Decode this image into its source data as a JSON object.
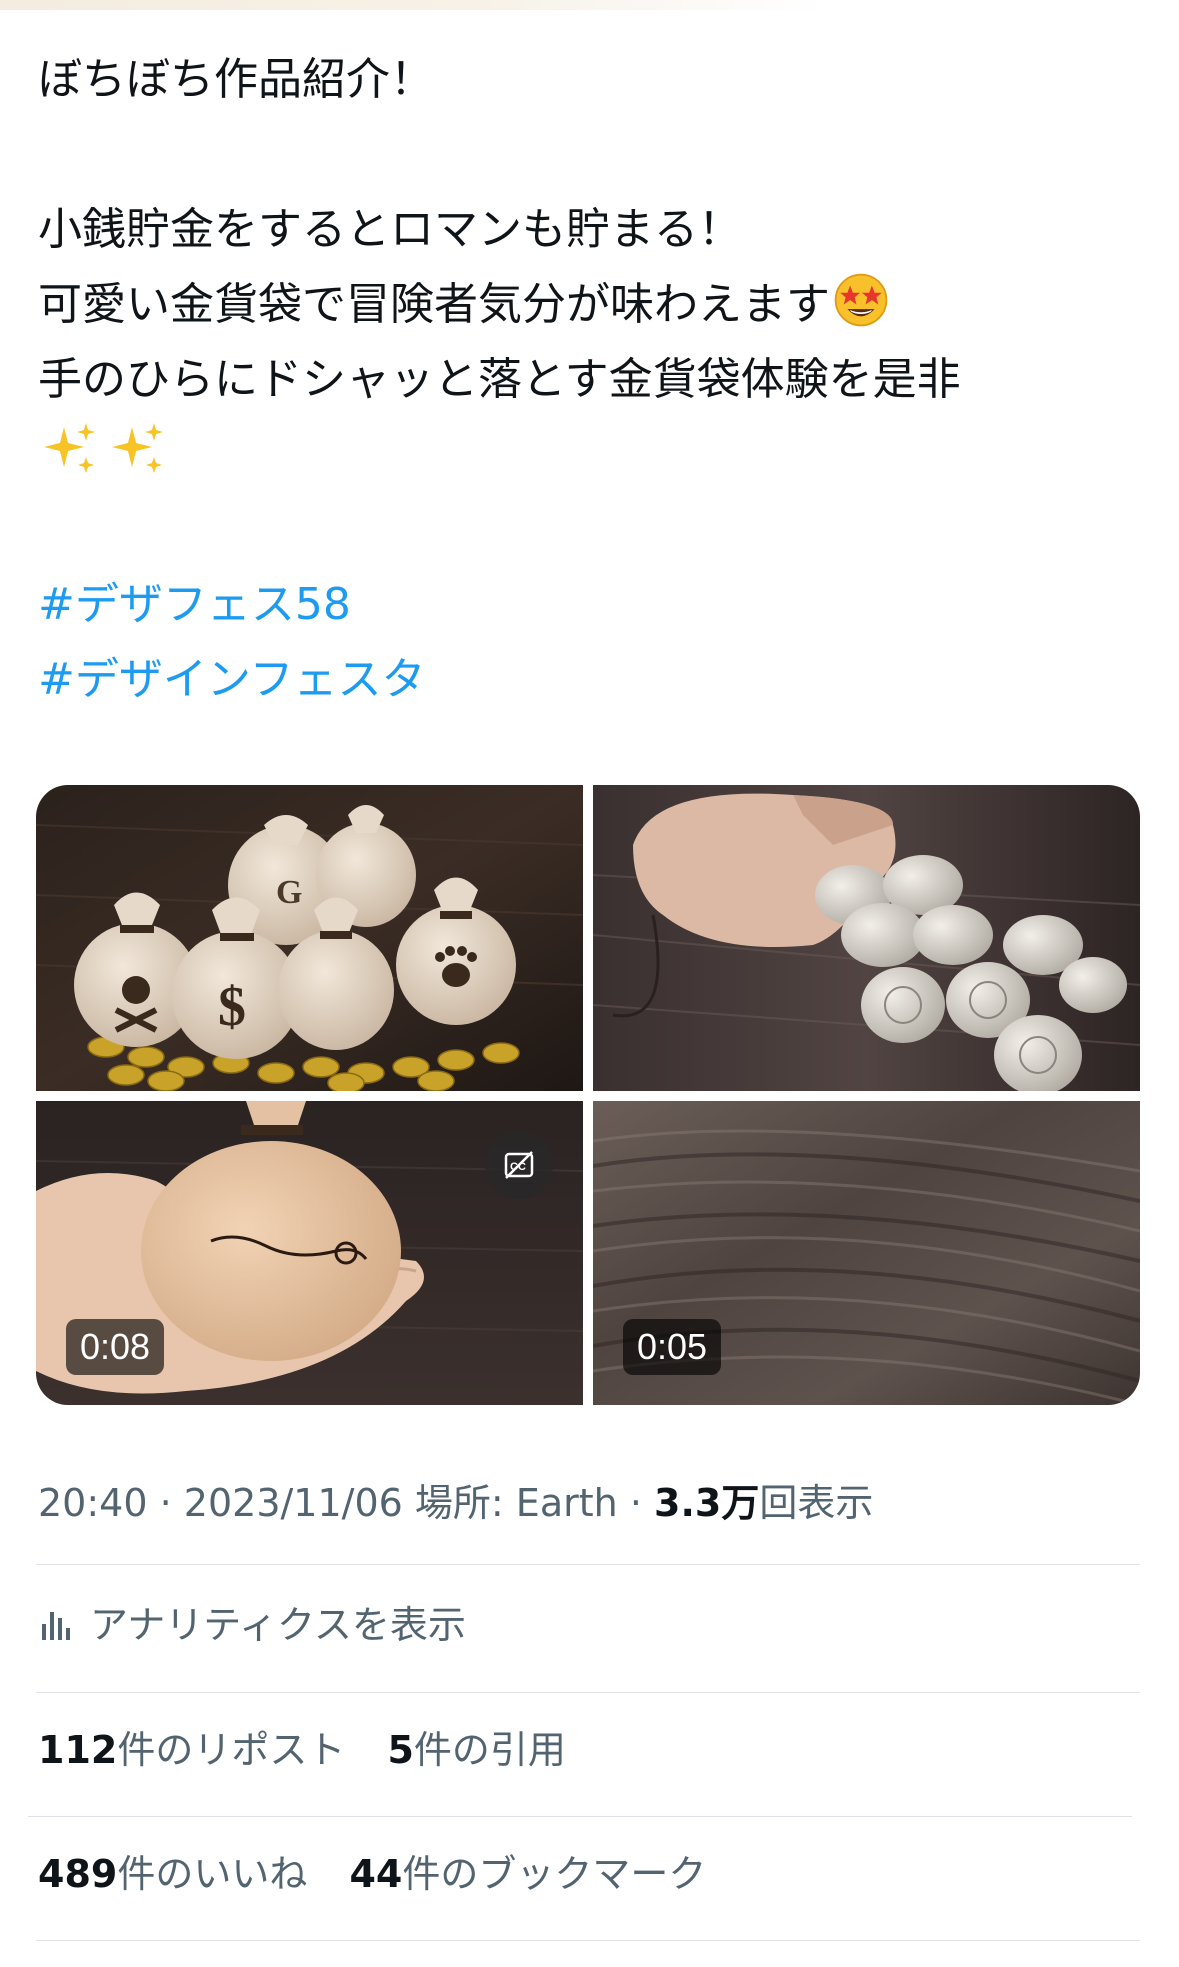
{
  "tweet": {
    "line1": "ぼちぼち作品紹介！",
    "line2": "小銭貯金をするとロマンも貯まる！",
    "line3": "可愛い金貨袋で冒険者気分が味わえます",
    "line3_emoji": "star-struck-emoji",
    "line4": "手のひらにドシャッと落とす金貨袋体験を是非",
    "line5_emoji": "sparkles-emoji",
    "hashtag1": "#デザフェス58",
    "hashtag2": "#デザインフェスタ"
  },
  "media": [
    {
      "type": "photo",
      "subject": "money-bags-with-gold-coins"
    },
    {
      "type": "photo",
      "subject": "leather-pouch-with-yen-coins"
    },
    {
      "type": "video",
      "duration": "0:08",
      "subject": "pouch-in-hand",
      "icon": "captions-off-icon"
    },
    {
      "type": "video",
      "duration": "0:05",
      "subject": "wooden-table"
    }
  ],
  "meta": {
    "time": "20:40",
    "sep1": "·",
    "date": "2023/11/06",
    "location_label": "場所: Earth",
    "sep2": "·",
    "views_count": "3.3万",
    "views_label": "回表示"
  },
  "analytics": {
    "icon": "bar-chart-icon",
    "label": "アナリティクスを表示"
  },
  "stats": {
    "reposts_count": "112",
    "reposts_label": "件のリポスト",
    "quotes_count": "5",
    "quotes_label": "件の引用",
    "likes_count": "489",
    "likes_label": "件のいいね",
    "bookmarks_count": "44",
    "bookmarks_label": "件のブックマーク"
  },
  "colors": {
    "text": "#0f1419",
    "muted": "#536471",
    "link": "#1d9bf0",
    "divider": "#dfe3e7"
  }
}
